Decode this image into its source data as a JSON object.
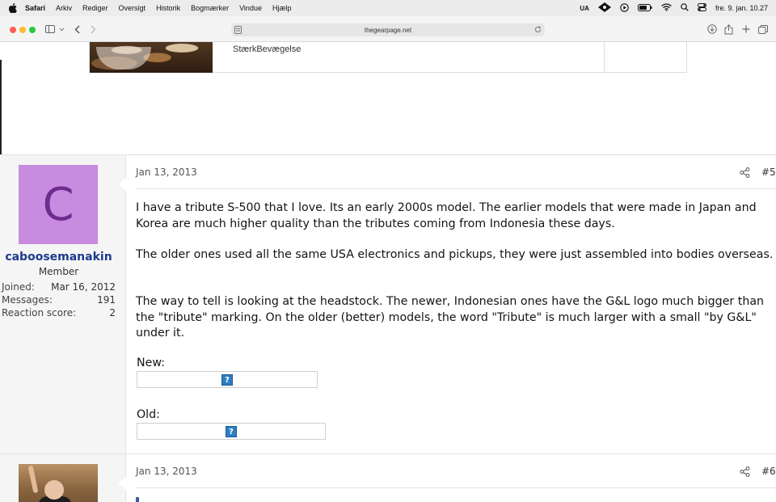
{
  "menubar": {
    "app": "Safari",
    "items": [
      "Arkiv",
      "Rediger",
      "Oversigt",
      "Historik",
      "Bogmærker",
      "Vindue",
      "Hjælp"
    ],
    "input_source": "UA",
    "clock": "fre. 9. jan. 10.27"
  },
  "browser": {
    "url": "thegearpage.net"
  },
  "ad": {
    "brand": "StærkBevægelse"
  },
  "posts": [
    {
      "date": "Jan 13, 2013",
      "number": "#5",
      "avatar_letter": "C",
      "username": "caboosemanakin",
      "user_title": "Member",
      "stats": [
        {
          "label": "Joined:",
          "value": "Mar 16, 2012"
        },
        {
          "label": "Messages:",
          "value": "191"
        },
        {
          "label": "Reaction score:",
          "value": "2"
        }
      ],
      "paragraphs": [
        "I have a tribute S-500 that I love. Its an early 2000s model. The earlier models that were made in Japan and Korea are much higher quality than the tributes coming from Indonesia these days.",
        "The older ones used all the same USA electronics and pickups, they were just assembled into bodies overseas.",
        "The way to tell is looking at the headstock. The newer, Indonesian ones have the G&L logo much bigger than the \"tribute\" marking. On the older (better) models, the word \"Tribute\" is much larger with a small \"by G&L\" under it."
      ],
      "new_label": "New:",
      "old_label": "Old:",
      "broken_image_glyph": "?"
    },
    {
      "date": "Jan 13, 2013",
      "number": "#6"
    }
  ],
  "colors": {
    "username": "#1d3a8f",
    "avatar_bg": "#c78be0",
    "avatar_fg": "#6e2c8e"
  }
}
